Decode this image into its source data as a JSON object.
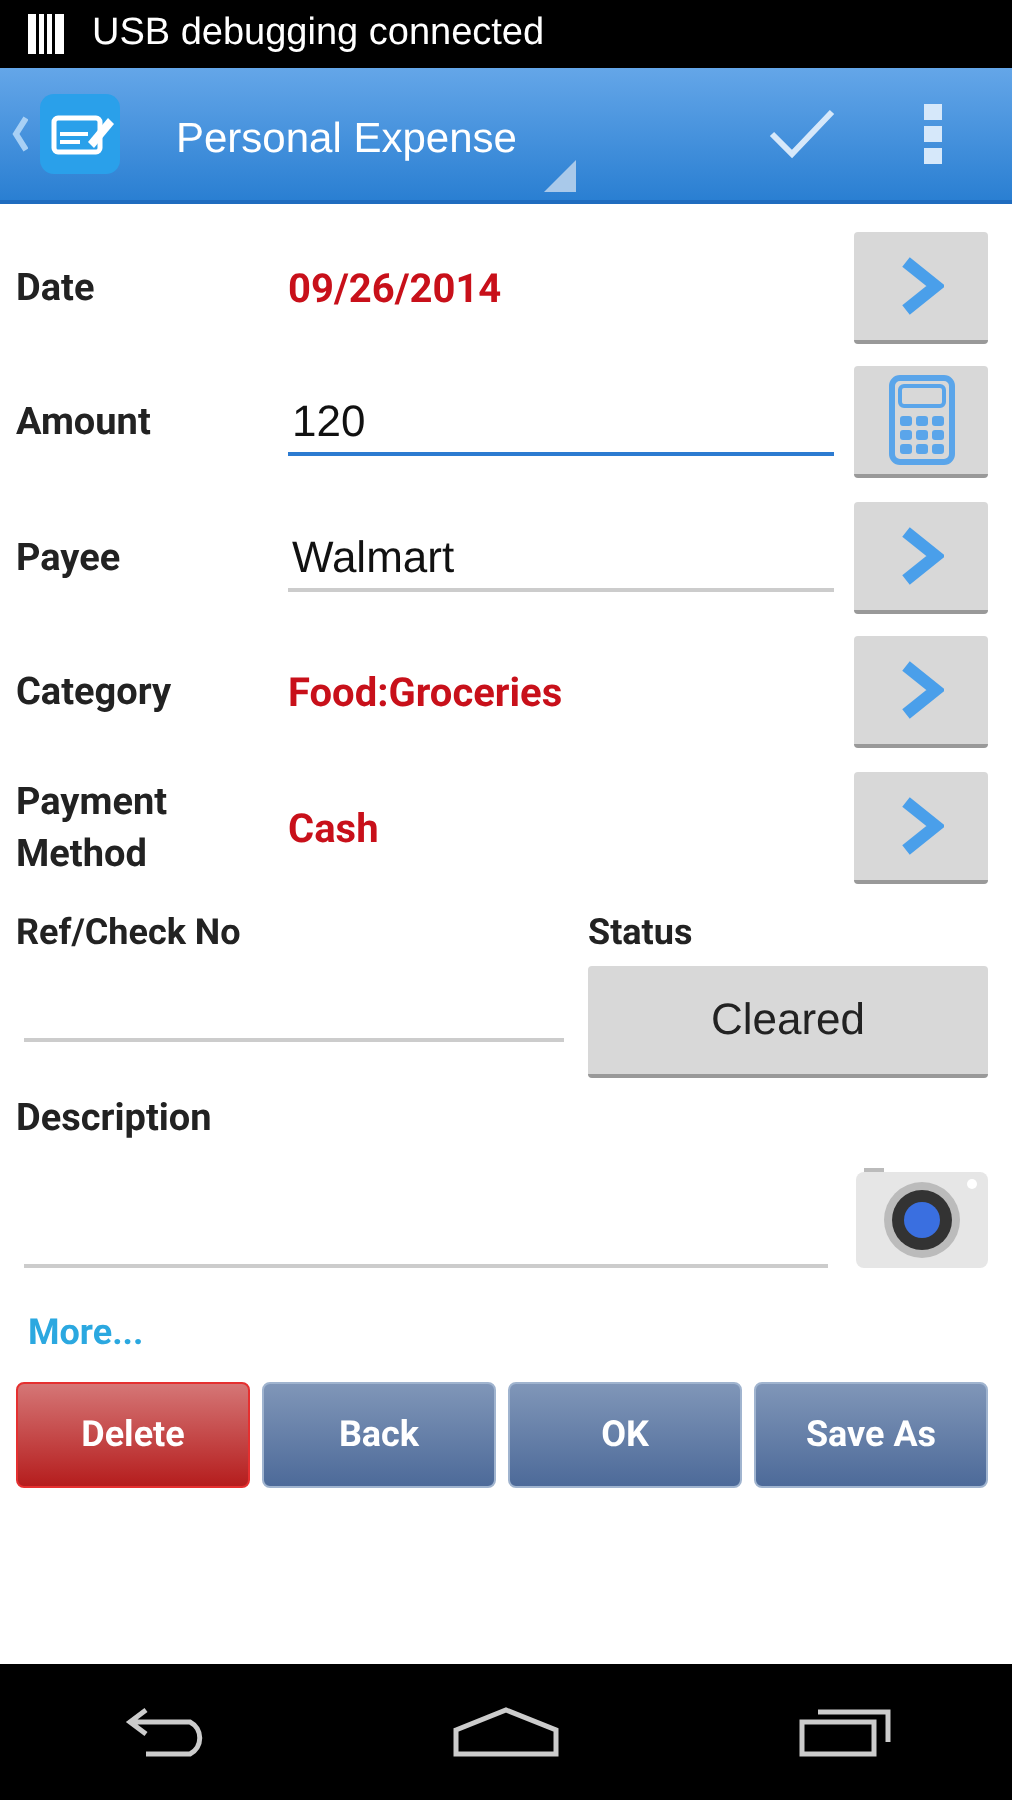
{
  "status_bar": {
    "notification": "USB debugging connected"
  },
  "action_bar": {
    "title": "Personal Expense"
  },
  "fields": [
    {
      "label": "Date",
      "kind": "picker",
      "value": "09/26/2014",
      "button": {
        "kind": "chevron"
      }
    },
    {
      "label": "Amount",
      "kind": "input",
      "value": "120",
      "focused": true,
      "button": {
        "kind": "calculator"
      }
    },
    {
      "label": "Payee",
      "kind": "input",
      "value": "Walmart",
      "focused": false,
      "button": {
        "kind": "chevron"
      }
    },
    {
      "label": "Category",
      "kind": "picker",
      "value": "Food:Groceries",
      "button": {
        "kind": "chevron"
      }
    },
    {
      "label": "Payment Method",
      "kind": "picker",
      "value": "Cash",
      "button": {
        "kind": "chevron"
      }
    }
  ],
  "ref_check": {
    "label": "Ref/Check No"
  },
  "status": {
    "label": "Status",
    "value": "Cleared"
  },
  "description": {
    "label": "Description"
  },
  "more_link": "More...",
  "buttons": [
    {
      "label": "Delete",
      "kind": "danger"
    },
    {
      "label": "Back",
      "kind": "normal"
    },
    {
      "label": "OK",
      "kind": "normal"
    },
    {
      "label": "Save As",
      "kind": "normal"
    }
  ]
}
